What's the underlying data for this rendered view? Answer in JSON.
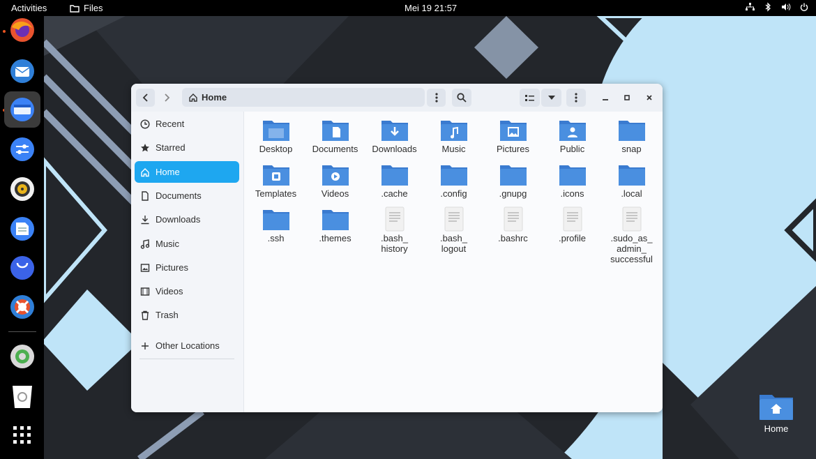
{
  "topbar": {
    "activities": "Activities",
    "app_name": "Files",
    "clock": "Mei 19  21:57"
  },
  "dock": {
    "apps": [
      {
        "name": "Firefox",
        "icon": "firefox-icon",
        "color": "#e8532e"
      },
      {
        "name": "Thunderbird",
        "icon": "thunderbird-icon",
        "color": "#2f7fd8"
      },
      {
        "name": "Files",
        "icon": "files-icon",
        "color": "#3b82f6",
        "active": true
      },
      {
        "name": "Settings",
        "icon": "settings-icon",
        "color": "#3b82f6"
      },
      {
        "name": "Rhythmbox",
        "icon": "rhythmbox-icon",
        "color": "#e8b31a"
      },
      {
        "name": "Text Editor",
        "icon": "text-editor-icon",
        "color": "#3b82f6"
      },
      {
        "name": "App Center",
        "icon": "app-center-icon",
        "color": "#3b63e8"
      },
      {
        "name": "Help",
        "icon": "help-icon",
        "color": "#e8532e"
      },
      {
        "name": "Disk",
        "icon": "disk-icon",
        "color": "#4caf50"
      },
      {
        "name": "Trash",
        "icon": "trash-icon",
        "color": "#ffffff"
      },
      {
        "name": "Show Apps",
        "icon": "show-apps-icon",
        "color": "#ffffff"
      }
    ]
  },
  "window": {
    "path_label": "Home",
    "sidebar": {
      "items": [
        {
          "label": "Recent",
          "icon": "recent-icon"
        },
        {
          "label": "Starred",
          "icon": "star-icon"
        },
        {
          "label": "Home",
          "icon": "home-icon",
          "selected": true
        },
        {
          "label": "Documents",
          "icon": "documents-icon"
        },
        {
          "label": "Downloads",
          "icon": "downloads-icon"
        },
        {
          "label": "Music",
          "icon": "music-icon"
        },
        {
          "label": "Pictures",
          "icon": "pictures-icon"
        },
        {
          "label": "Videos",
          "icon": "videos-icon"
        },
        {
          "label": "Trash",
          "icon": "trash-icon"
        }
      ],
      "other_locations": "Other Locations"
    },
    "files": [
      {
        "label": "Desktop",
        "kind": "folder",
        "emblem": "desktop"
      },
      {
        "label": "Documents",
        "kind": "folder",
        "emblem": "document"
      },
      {
        "label": "Downloads",
        "kind": "folder",
        "emblem": "download"
      },
      {
        "label": "Music",
        "kind": "folder",
        "emblem": "music"
      },
      {
        "label": "Pictures",
        "kind": "folder",
        "emblem": "picture"
      },
      {
        "label": "Public",
        "kind": "folder",
        "emblem": "user"
      },
      {
        "label": "snap",
        "kind": "folder",
        "emblem": ""
      },
      {
        "label": "Templates",
        "kind": "folder",
        "emblem": "template"
      },
      {
        "label": "Videos",
        "kind": "folder",
        "emblem": "video"
      },
      {
        "label": ".cache",
        "kind": "folder",
        "emblem": ""
      },
      {
        "label": ".config",
        "kind": "folder",
        "emblem": ""
      },
      {
        "label": ".gnupg",
        "kind": "folder",
        "emblem": ""
      },
      {
        "label": ".icons",
        "kind": "folder",
        "emblem": ""
      },
      {
        "label": ".local",
        "kind": "folder",
        "emblem": ""
      },
      {
        "label": ".ssh",
        "kind": "folder",
        "emblem": ""
      },
      {
        "label": ".themes",
        "kind": "folder",
        "emblem": ""
      },
      {
        "label": ".bash_\nhistory",
        "kind": "file",
        "emblem": ""
      },
      {
        "label": ".bash_\nlogout",
        "kind": "file",
        "emblem": ""
      },
      {
        "label": ".bashrc",
        "kind": "file",
        "emblem": ""
      },
      {
        "label": ".profile",
        "kind": "file",
        "emblem": ""
      },
      {
        "label": ".sudo_as_\nadmin_\nsuccessful",
        "kind": "file",
        "emblem": ""
      }
    ]
  },
  "desktop": {
    "home_label": "Home"
  },
  "colors": {
    "accent": "#1ea7f0",
    "folder": "#4a8fe0",
    "folder_tab": "#3a7bd0"
  }
}
